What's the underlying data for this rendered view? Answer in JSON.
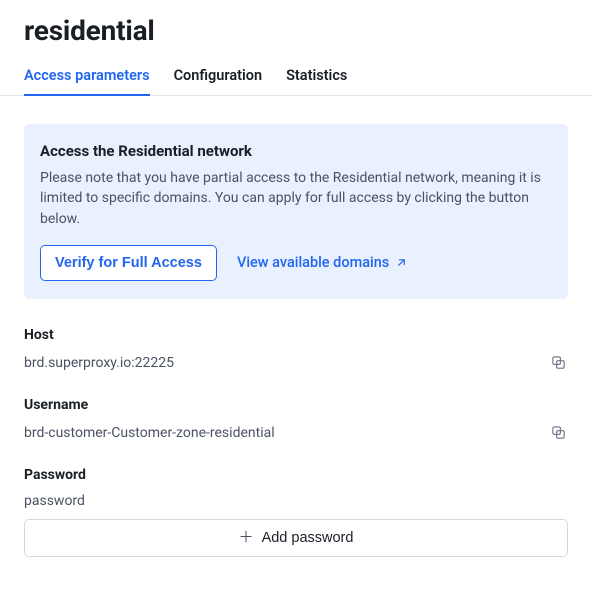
{
  "page": {
    "title": "residential"
  },
  "tabs": [
    {
      "label": "Access parameters",
      "active": true
    },
    {
      "label": "Configuration",
      "active": false
    },
    {
      "label": "Statistics",
      "active": false
    }
  ],
  "notice": {
    "title": "Access the Residential network",
    "body": "Please note that you have partial access to the Residential network, meaning it is limited to specific domains. You can apply for full access by clicking the button below.",
    "verify_button": "Verify for Full Access",
    "view_domains_link": "View available domains"
  },
  "fields": {
    "host": {
      "label": "Host",
      "value": "brd.superproxy.io:22225"
    },
    "username": {
      "label": "Username",
      "value": "brd-customer-Customer-zone-residential"
    },
    "password": {
      "label": "Password",
      "value": "password",
      "add_button": "Add password"
    }
  }
}
